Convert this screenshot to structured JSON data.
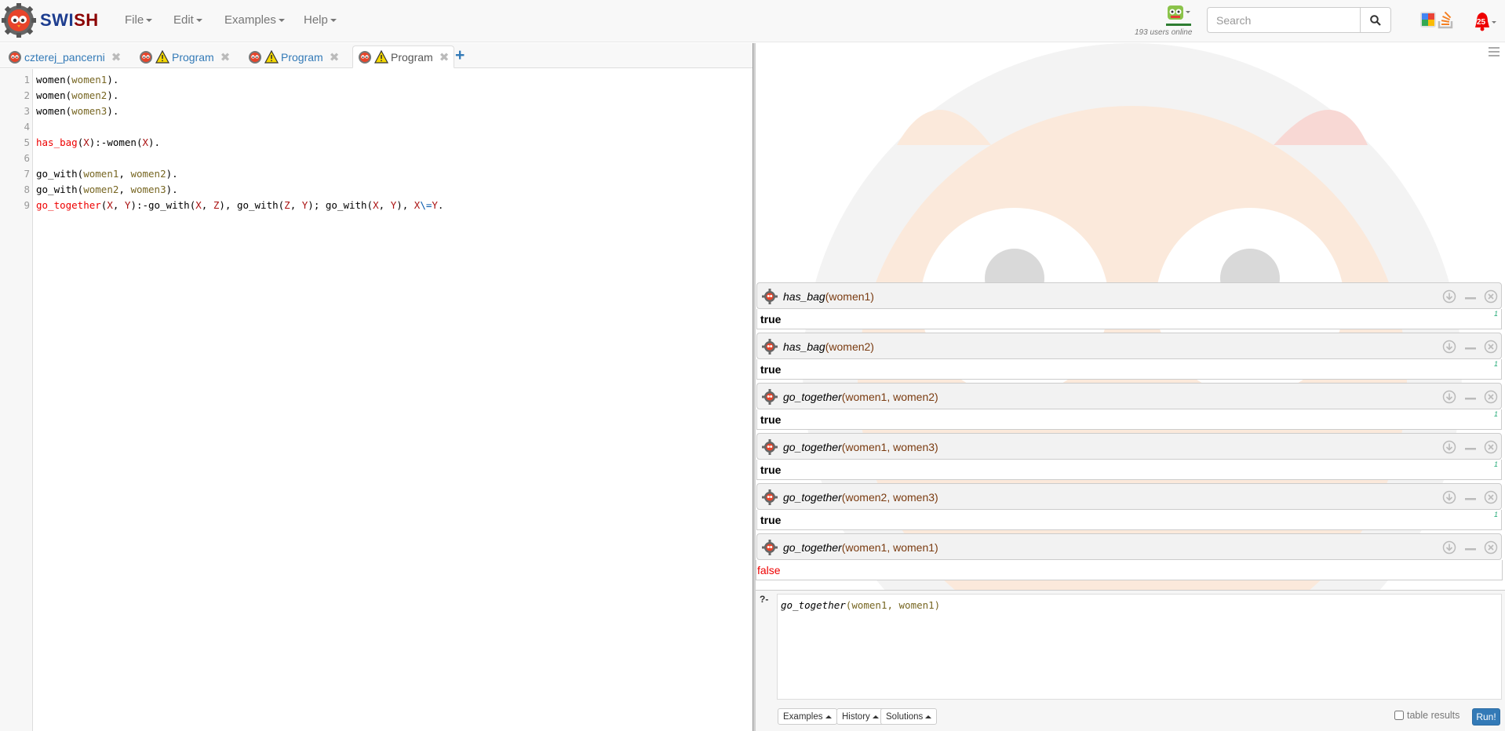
{
  "app": {
    "brand_part1": "SWI",
    "brand_part2": "SH"
  },
  "menu": {
    "file": "File",
    "edit": "Edit",
    "examples": "Examples",
    "help": "Help"
  },
  "status": {
    "online": "193 users online",
    "notifications": "25"
  },
  "search": {
    "placeholder": "Search",
    "value": ""
  },
  "tabs": [
    {
      "label": "czterej_pancerni",
      "warning": false,
      "active": false
    },
    {
      "label": "Program",
      "warning": true,
      "active": false
    },
    {
      "label": "Program",
      "warning": true,
      "active": false
    },
    {
      "label": "Program",
      "warning": true,
      "active": true
    }
  ],
  "tab_close": "✖",
  "tab_add": "+",
  "editor": {
    "line_numbers": [
      "1",
      "2",
      "3",
      "4",
      "5",
      "6",
      "7",
      "8",
      "9"
    ],
    "lines": [
      "women(women1).",
      "women(women2).",
      "women(women3).",
      "",
      "has_bag(X):-women(X).",
      "",
      "go_with(women1, women2).",
      "go_with(women2, women3).",
      "go_together(X, Y):-go_with(X, Z), go_with(Z, Y); go_with(X, Y), X\\=Y."
    ]
  },
  "queries": [
    {
      "pred": "has_bag",
      "args": "(women1)",
      "result": "true",
      "count": "1"
    },
    {
      "pred": "has_bag",
      "args": "(women2)",
      "result": "true",
      "count": "1"
    },
    {
      "pred": "go_together",
      "args": "(women1, women2)",
      "result": "true",
      "count": "1"
    },
    {
      "pred": "go_together",
      "args": "(women1, women3)",
      "result": "true",
      "count": "1"
    },
    {
      "pred": "go_together",
      "args": "(women2, women3)",
      "result": "true",
      "count": "1"
    },
    {
      "pred": "go_together",
      "args": "(women1, women1)",
      "result": "false",
      "count": ""
    }
  ],
  "query_editor": {
    "prompt": "?-",
    "pred": "go_together",
    "args": "(women1, women1)"
  },
  "query_buttons": {
    "examples": "Examples",
    "history": "History",
    "solutions": "Solutions"
  },
  "table_results_label": "table results",
  "run_label": "Run!",
  "colors": {
    "primary": "#337ab7",
    "brand_blue": "#1d3d8f",
    "brand_red": "#8b0000",
    "false_red": "#e00000"
  }
}
